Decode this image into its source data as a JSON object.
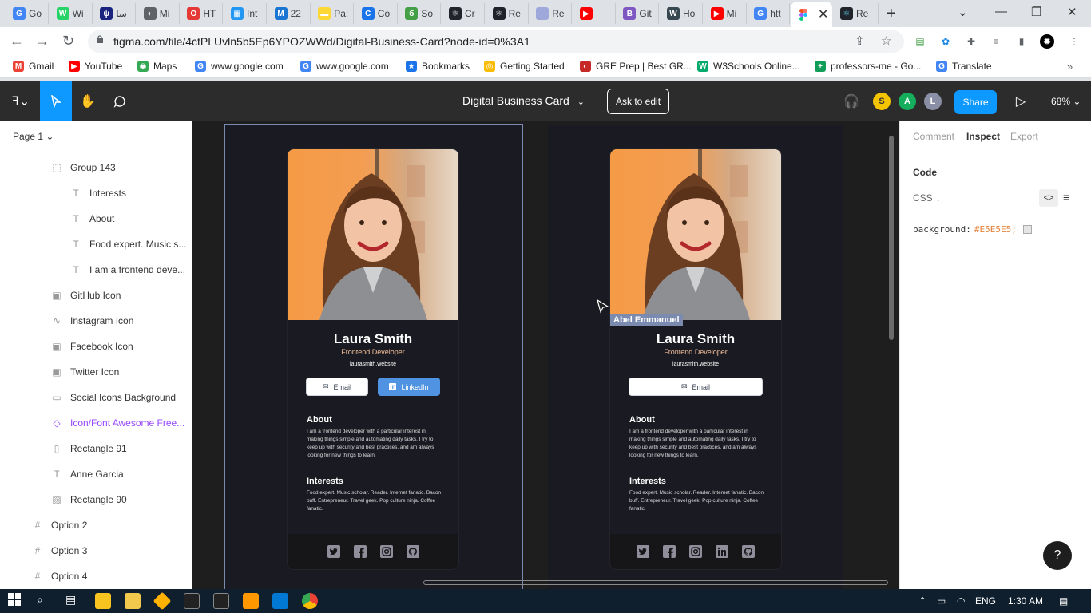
{
  "browser": {
    "tabs": [
      {
        "label": "Go",
        "color": "#4285f4",
        "glyph": "G"
      },
      {
        "label": "Wi",
        "color": "#25d366",
        "glyph": "W"
      },
      {
        "label": "ﺳﺎ",
        "color": "#1a237e",
        "glyph": "ψ"
      },
      {
        "label": "Mi",
        "color": "#5f6368",
        "glyph": "◐"
      },
      {
        "label": "HT",
        "color": "#e53935",
        "glyph": "O"
      },
      {
        "label": "Int",
        "color": "#2196f3",
        "glyph": "▦"
      },
      {
        "label": "22",
        "color": "#1976d2",
        "glyph": "M"
      },
      {
        "label": "Pa:",
        "color": "#fdd835",
        "glyph": "▬"
      },
      {
        "label": "Co",
        "color": "#1a73e8",
        "glyph": "C"
      },
      {
        "label": "So",
        "color": "#43a047",
        "glyph": "б"
      },
      {
        "label": "Cr",
        "color": "#20232a",
        "glyph": "⚛"
      },
      {
        "label": "Re",
        "color": "#20232a",
        "glyph": "⚛"
      },
      {
        "label": "Re",
        "color": "#9fa8da",
        "glyph": "—"
      },
      {
        "label": "",
        "color": "#ff0000",
        "glyph": "▶"
      },
      {
        "label": "Git",
        "color": "#7e57c2",
        "glyph": "B"
      },
      {
        "label": "Ho",
        "color": "#37474f",
        "glyph": "W"
      },
      {
        "label": "Mi",
        "color": "#ff0000",
        "glyph": "▶"
      },
      {
        "label": "htt",
        "color": "#4285f4",
        "glyph": "G"
      }
    ],
    "active_tab_label": "",
    "last_tab_label": "Re",
    "url": "figma.com/file/4ctPLUvln5b5Ep6YPOZWWd/Digital-Business-Card?node-id=0%3A1",
    "bookmarks": [
      {
        "label": "Gmail",
        "glyph": "M",
        "color": "#ea4335"
      },
      {
        "label": "YouTube",
        "glyph": "▶",
        "color": "#ff0000"
      },
      {
        "label": "Maps",
        "glyph": "◉",
        "color": "#34a853"
      },
      {
        "label": "www.google.com",
        "glyph": "G",
        "color": "#4285f4"
      },
      {
        "label": "www.google.com",
        "glyph": "G",
        "color": "#4285f4"
      },
      {
        "label": "Bookmarks",
        "glyph": "★",
        "color": "#1a73e8"
      },
      {
        "label": "Getting Started",
        "glyph": "◎",
        "color": "#fbbc04"
      },
      {
        "label": "GRE Prep | Best GR...",
        "glyph": "◐",
        "color": "#c62828"
      },
      {
        "label": "W3Schools Online...",
        "glyph": "W",
        "color": "#04aa6d"
      },
      {
        "label": "professors-me - Go...",
        "glyph": "+",
        "color": "#0f9d58"
      },
      {
        "label": "Translate",
        "glyph": "G",
        "color": "#4285f4"
      }
    ]
  },
  "figma": {
    "doc_title": "Digital Business Card",
    "ask_to_edit": "Ask to edit",
    "share": "Share",
    "zoom": "68%",
    "avatars": [
      {
        "initial": "S",
        "color": "#f5c400"
      },
      {
        "initial": "A",
        "color": "#14ae5c"
      },
      {
        "initial": "L",
        "color": "#8a8fa6"
      }
    ],
    "page": "Page 1",
    "layers": [
      {
        "label": "Group 143",
        "icon": "⬚",
        "indent": 1
      },
      {
        "label": "Interests",
        "icon": "T",
        "indent": 2
      },
      {
        "label": "About",
        "icon": "T",
        "indent": 2
      },
      {
        "label": "Food expert. Music s...",
        "icon": "T",
        "indent": 2
      },
      {
        "label": "I am a frontend deve...",
        "icon": "T",
        "indent": 2
      },
      {
        "label": "GitHub Icon",
        "icon": "▣",
        "indent": 1
      },
      {
        "label": "Instagram Icon",
        "icon": "∿",
        "indent": 1
      },
      {
        "label": "Facebook Icon",
        "icon": "▣",
        "indent": 1
      },
      {
        "label": "Twitter Icon",
        "icon": "▣",
        "indent": 1
      },
      {
        "label": "Social Icons Background",
        "icon": "▭",
        "indent": 1
      },
      {
        "label": "Icon/Font Awesome Free...",
        "icon": "◇",
        "indent": 1,
        "purple": true
      },
      {
        "label": "Rectangle 91",
        "icon": "▯",
        "indent": 1
      },
      {
        "label": "Anne Garcia",
        "icon": "T",
        "indent": 1
      },
      {
        "label": "Rectangle 90",
        "icon": "▨",
        "indent": 1
      },
      {
        "label": "Option 2",
        "icon": "#",
        "indent": 0
      },
      {
        "label": "Option 3",
        "icon": "#",
        "indent": 0
      },
      {
        "label": "Option 4",
        "icon": "#",
        "indent": 0
      }
    ],
    "inspect": {
      "tabs": [
        "Comment",
        "Inspect",
        "Export"
      ],
      "active": "Inspect",
      "code_label": "Code",
      "lang": "CSS",
      "prop": "background:",
      "value": "#E5E5E5;",
      "swatch": "#E5E5E5"
    },
    "cursor_tag": "Abel Emmanuel",
    "help": "?"
  },
  "cards": [
    {
      "name": "Laura Smith",
      "role": "Frontend Developer",
      "site": "laurasmith.website",
      "email_label": "Email",
      "linkedin_label": "LinkedIn",
      "about_title": "About",
      "about_text": "I am a frontend developer with a particular interest in making things simple and automating daily tasks. I try to keep up with security and best practices, and am always looking for new things to learn.",
      "interests_title": "Interests",
      "interests_text": "Food expert. Music scholar. Reader. Internet fanatic. Bacon buff. Entrepreneur. Travel geek. Pop culture ninja. Coffee fanatic.",
      "social": [
        "twitter-icon",
        "facebook-icon",
        "instagram-icon",
        "github-icon"
      ]
    },
    {
      "name": "Laura Smith",
      "role": "Frontend Developer",
      "site": "laurasmith.website",
      "email_label": "Email",
      "about_title": "About",
      "about_text": "I am a frontend developer with a particular interest in making things simple and automating daily tasks. I try to keep up with security and best practices, and am always looking for new things to learn.",
      "interests_title": "Interests",
      "interests_text": "Food expert. Music scholar. Reader. Internet fanatic. Bacon buff. Entrepreneur. Travel geek. Pop culture ninja. Coffee fanatic.",
      "social": [
        "twitter-icon",
        "facebook-icon",
        "instagram-icon",
        "linkedin-icon",
        "github-icon"
      ]
    }
  ],
  "taskbar": {
    "lang": "ENG",
    "time": "1:30 AM"
  }
}
